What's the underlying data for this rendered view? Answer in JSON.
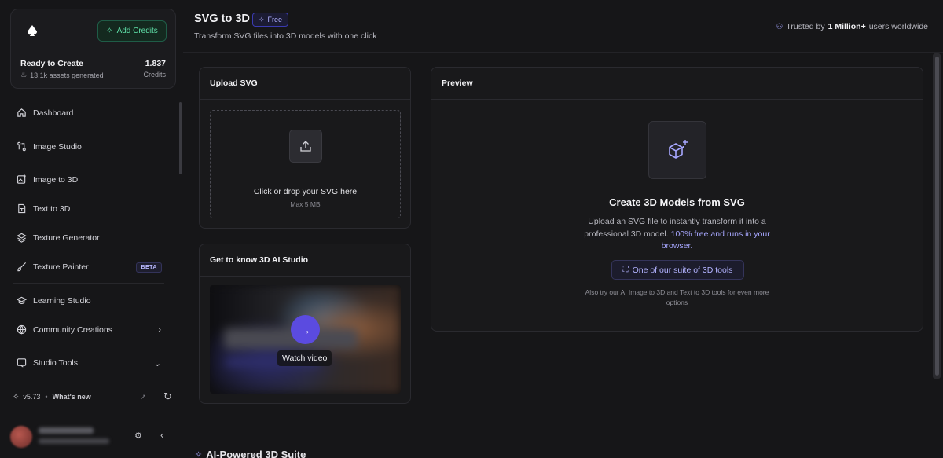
{
  "sidebar": {
    "add_credits_label": "Add Credits",
    "status_title": "Ready to Create",
    "assets_generated": "13.1k assets generated",
    "credits_value": "1.837",
    "credits_label": "Credits",
    "items": [
      {
        "label": "Dashboard",
        "icon": "home-icon"
      },
      {
        "label": "Image Studio",
        "icon": "git-compare-icon"
      },
      {
        "label": "Image to 3D",
        "icon": "image-plus-icon"
      },
      {
        "label": "Text to 3D",
        "icon": "text-file-icon"
      },
      {
        "label": "Texture Generator",
        "icon": "layers-icon"
      },
      {
        "label": "Texture Painter",
        "icon": "paintbrush-icon",
        "badge": "BETA"
      },
      {
        "label": "Learning Studio",
        "icon": "graduation-cap-icon"
      },
      {
        "label": "Community Creations",
        "icon": "globe-icon"
      },
      {
        "label": "Studio Tools",
        "icon": "tools-icon"
      }
    ],
    "version": "v5.73",
    "whats_new": "What's new"
  },
  "header": {
    "title": "SVG to 3D",
    "badge": "Free",
    "subtitle": "Transform SVG files into 3D models with one click",
    "trusted_prefix": "Trusted by",
    "trusted_bold": "1 Million+",
    "trusted_suffix": "users worldwide"
  },
  "upload": {
    "title": "Upload SVG",
    "drop_text": "Click or drop your SVG here",
    "max_size": "Max 5 MB"
  },
  "learn": {
    "title": "Get to know 3D AI Studio",
    "watch_label": "Watch video"
  },
  "preview": {
    "title": "Preview",
    "heading": "Create 3D Models from SVG",
    "desc_plain": "Upload an SVG file to instantly transform it into a professional 3D model.",
    "desc_highlight": "100% free and runs in your browser.",
    "suite_button": "One of our suite of 3D tools",
    "also_text": "Also try our AI Image to 3D and Text to 3D tools for even more options"
  },
  "section": {
    "heading": "AI-Powered 3D Suite"
  },
  "colors": {
    "background": "#161618",
    "accent": "#5b4be0",
    "credits_green": "#5fe0a8"
  }
}
